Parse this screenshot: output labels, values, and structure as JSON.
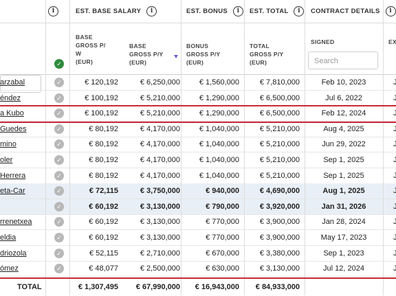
{
  "groups": {
    "salary": "EST. BASE SALARY",
    "bonus": "EST. BONUS",
    "total": "EST. TOTAL",
    "contract": "CONTRACT DETAILS"
  },
  "subheaders": {
    "weekly": [
      "BASE",
      "GROSS P/",
      "W",
      "(EUR)"
    ],
    "yearly": [
      "BASE",
      "GROSS P/Y",
      "(EUR)"
    ],
    "bonus": [
      "BONUS",
      "GROSS P/Y",
      "(EUR)"
    ],
    "total": [
      "TOTAL",
      "GROSS P/Y",
      "(EUR)"
    ],
    "signed": "SIGNED",
    "ex": "EX"
  },
  "search": {
    "placeholder": "Search"
  },
  "rows": [
    {
      "name": "arzabal",
      "weekly": "€ 120,192",
      "yearly": "€ 6,250,000",
      "bonus": "€ 1,560,000",
      "total": "€ 7,810,000",
      "signed": "Feb 10, 2023",
      "bold": false,
      "alt": false
    },
    {
      "name": "éndez",
      "weekly": "€ 100,192",
      "yearly": "€ 5,210,000",
      "bonus": "€ 1,290,000",
      "total": "€ 6,500,000",
      "signed": "Jul 6, 2022",
      "bold": false,
      "alt": false
    },
    {
      "name": "a Kubo",
      "weekly": "€ 100,192",
      "yearly": "€ 5,210,000",
      "bonus": "€ 1,290,000",
      "total": "€ 6,500,000",
      "signed": "Feb 12, 2024",
      "bold": false,
      "alt": false
    },
    {
      "name": "Guedes",
      "weekly": "€ 80,192",
      "yearly": "€ 4,170,000",
      "bonus": "€ 1,040,000",
      "total": "€ 5,210,000",
      "signed": "Aug 4, 2025",
      "bold": false,
      "alt": false
    },
    {
      "name": "mino",
      "weekly": "€ 80,192",
      "yearly": "€ 4,170,000",
      "bonus": "€ 1,040,000",
      "total": "€ 5,210,000",
      "signed": "Jun 29, 2022",
      "bold": false,
      "alt": false
    },
    {
      "name": "oler",
      "weekly": "€ 80,192",
      "yearly": "€ 4,170,000",
      "bonus": "€ 1,040,000",
      "total": "€ 5,210,000",
      "signed": "Sep 1, 2025",
      "bold": false,
      "alt": false
    },
    {
      "name": "Herrera",
      "weekly": "€ 80,192",
      "yearly": "€ 4,170,000",
      "bonus": "€ 1,040,000",
      "total": "€ 5,210,000",
      "signed": "Sep 1, 2025",
      "bold": false,
      "alt": false
    },
    {
      "name": "eta-Car",
      "weekly": "€ 72,115",
      "yearly": "€ 3,750,000",
      "bonus": "€ 940,000",
      "total": "€ 4,690,000",
      "signed": "Aug 1, 2025",
      "bold": true,
      "alt": true
    },
    {
      "name": "",
      "weekly": "€ 60,192",
      "yearly": "€ 3,130,000",
      "bonus": "€ 790,000",
      "total": "€ 3,920,000",
      "signed": "Jan 31, 2026",
      "bold": true,
      "alt": true
    },
    {
      "name": "rrenetxea",
      "weekly": "€ 60,192",
      "yearly": "€ 3,130,000",
      "bonus": "€ 770,000",
      "total": "€ 3,900,000",
      "signed": "Jan 28, 2024",
      "bold": false,
      "alt": false
    },
    {
      "name": "eldia",
      "weekly": "€ 60,192",
      "yearly": "€ 3,130,000",
      "bonus": "€ 770,000",
      "total": "€ 3,900,000",
      "signed": "May 17, 2023",
      "bold": false,
      "alt": false
    },
    {
      "name": "driozola",
      "weekly": "€ 52,115",
      "yearly": "€ 2,710,000",
      "bonus": "€ 670,000",
      "total": "€ 3,380,000",
      "signed": "Sep 1, 2023",
      "bold": false,
      "alt": false
    },
    {
      "name": "ómez",
      "weekly": "€ 48,077",
      "yearly": "€ 2,500,000",
      "bonus": "€ 630,000",
      "total": "€ 3,130,000",
      "signed": "Jul 12, 2024",
      "bold": false,
      "alt": false
    }
  ],
  "total_row": {
    "label": "TOTAL",
    "weekly": "€ 1,307,495",
    "yearly": "€ 67,990,000",
    "bonus": "€ 16,943,000",
    "total": "€ 84,933,000"
  },
  "colors": {
    "highlight": "#c8283a",
    "check_on": "#2e8b3c",
    "check_off": "#b8b8b8",
    "alt_row": "#e9eff6",
    "sort": "#6b5bd6"
  },
  "icons": [
    "info-icon",
    "check-icon",
    "sort-desc-icon"
  ]
}
